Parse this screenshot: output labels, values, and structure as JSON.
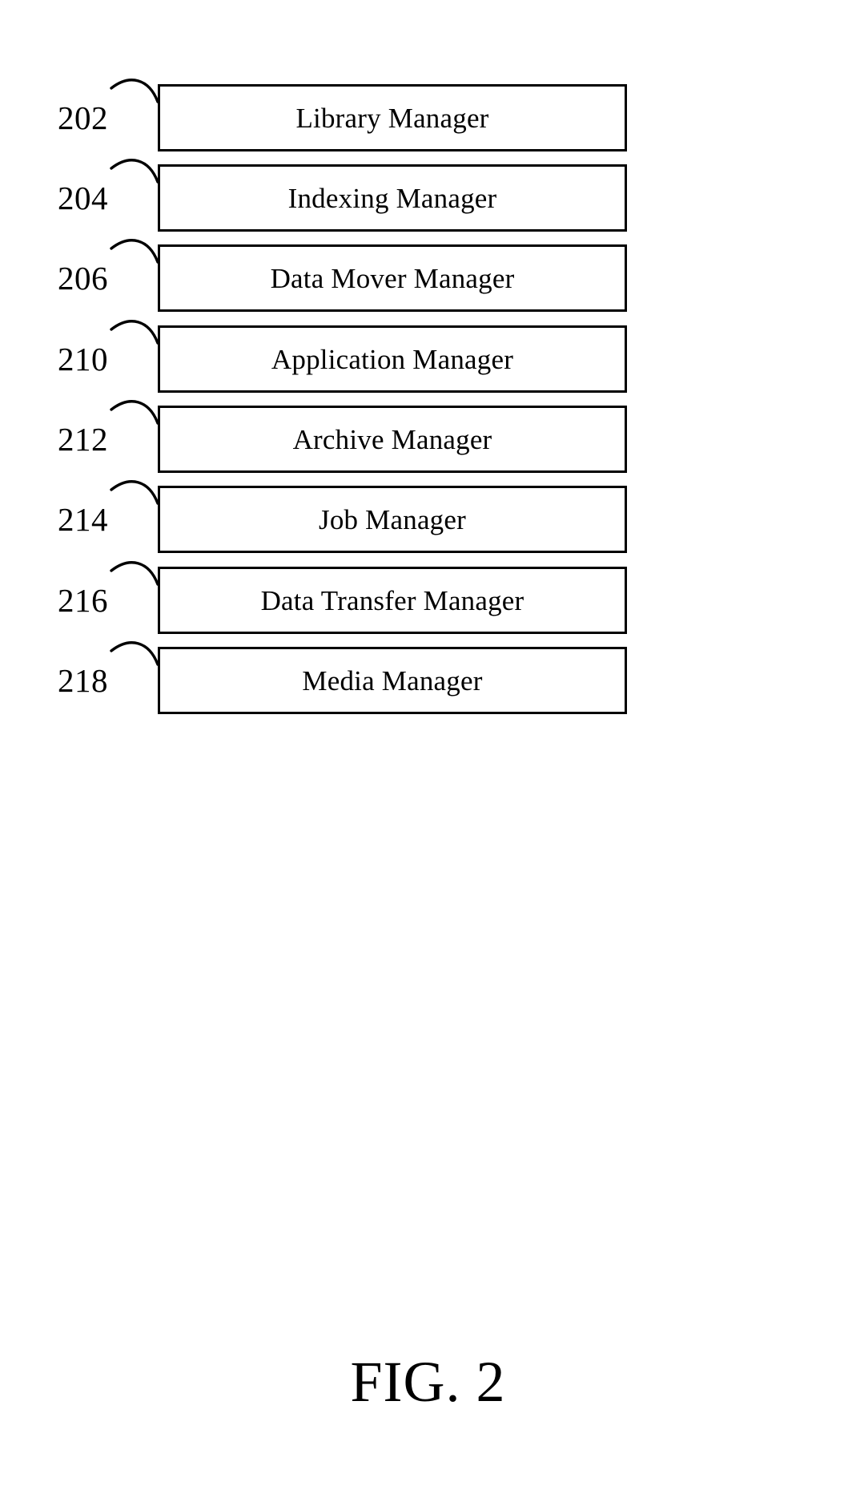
{
  "figure": {
    "caption": "FIG. 2",
    "blocks": [
      {
        "ref": "202",
        "label": "Library Manager"
      },
      {
        "ref": "204",
        "label": "Indexing Manager"
      },
      {
        "ref": "206",
        "label": "Data Mover Manager"
      },
      {
        "ref": "210",
        "label": "Application Manager"
      },
      {
        "ref": "212",
        "label": "Archive Manager"
      },
      {
        "ref": "214",
        "label": "Job Manager"
      },
      {
        "ref": "216",
        "label": "Data Transfer Manager"
      },
      {
        "ref": "218",
        "label": "Media Manager"
      }
    ]
  },
  "colors": {
    "ink": "#000000",
    "paper": "#ffffff"
  }
}
